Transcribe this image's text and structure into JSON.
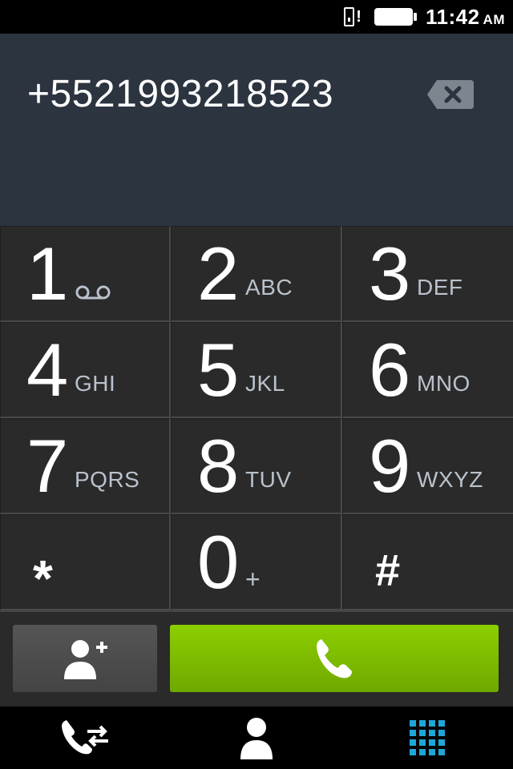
{
  "status_bar": {
    "time": "11:42",
    "ampm": "AM",
    "icons": [
      "sim-warning-icon",
      "battery-icon"
    ]
  },
  "display": {
    "number": "+5521993218523",
    "backspace_icon": "backspace-icon"
  },
  "keypad": {
    "keys": [
      {
        "digit": "1",
        "letters": "",
        "icon": "voicemail-icon"
      },
      {
        "digit": "2",
        "letters": "ABC"
      },
      {
        "digit": "3",
        "letters": "DEF"
      },
      {
        "digit": "4",
        "letters": "GHI"
      },
      {
        "digit": "5",
        "letters": "JKL"
      },
      {
        "digit": "6",
        "letters": "MNO"
      },
      {
        "digit": "7",
        "letters": "PQRS"
      },
      {
        "digit": "8",
        "letters": "TUV"
      },
      {
        "digit": "9",
        "letters": "WXYZ"
      },
      {
        "digit": "*",
        "letters": ""
      },
      {
        "digit": "0",
        "letters": "+"
      },
      {
        "digit": "#",
        "letters": ""
      }
    ]
  },
  "actions": {
    "add_contact_icon": "add-contact-icon",
    "call_icon": "phone-icon"
  },
  "nav": {
    "items": [
      {
        "icon": "call-log-icon",
        "active": false
      },
      {
        "icon": "contacts-icon",
        "active": false
      },
      {
        "icon": "keypad-icon",
        "active": true
      }
    ]
  },
  "colors": {
    "display_bg": "#2c3440",
    "call_green": "#7cbc00",
    "active_tab": "#1ea7d8",
    "letters": "#b9c2cc"
  }
}
